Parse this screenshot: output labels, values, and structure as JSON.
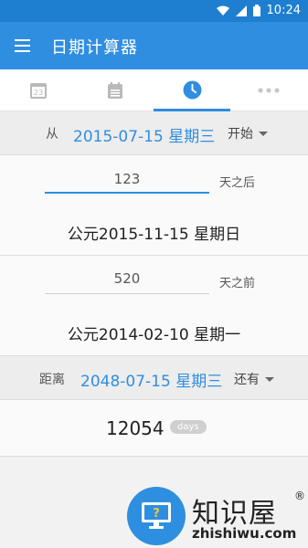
{
  "status_bar": {
    "time": "10:24",
    "icons": [
      "wifi-icon",
      "signal-icon",
      "battery-icon"
    ]
  },
  "app_bar": {
    "title": "日期计算器"
  },
  "tabs": [
    {
      "name": "calendar-23",
      "icon_text": "23",
      "active": false
    },
    {
      "name": "calendar-list",
      "active": false
    },
    {
      "name": "clock",
      "active": true
    },
    {
      "name": "more",
      "active": false
    }
  ],
  "start_row": {
    "label": "从",
    "date": "2015-07-15 星期三",
    "mode": "开始"
  },
  "after": {
    "value": "123",
    "suffix": "天之后",
    "result": "公元2015-11-15 星期日"
  },
  "before": {
    "value": "520",
    "suffix": "天之前",
    "result": "公元2014-02-10 星期一"
  },
  "distance_row": {
    "label": "距离",
    "date": "2048-07-15 星期三",
    "mode": "还有"
  },
  "countdown": {
    "value": "12054",
    "unit": "days"
  },
  "watermark": {
    "text": "知识屋",
    "reg": "®",
    "url": "zhishiwu.com"
  },
  "colors": {
    "primary": "#2f8ee0",
    "status_bar": "#1e7fd0"
  }
}
